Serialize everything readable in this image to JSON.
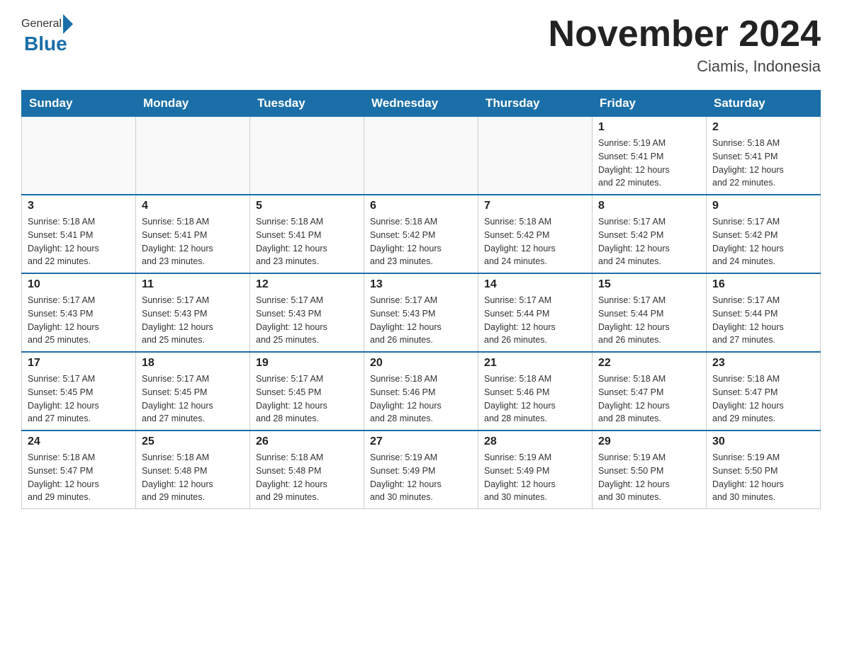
{
  "header": {
    "logo_general": "General",
    "logo_blue": "Blue",
    "title": "November 2024",
    "subtitle": "Ciamis, Indonesia"
  },
  "weekdays": [
    "Sunday",
    "Monday",
    "Tuesday",
    "Wednesday",
    "Thursday",
    "Friday",
    "Saturday"
  ],
  "weeks": [
    {
      "days": [
        {
          "number": "",
          "info": "",
          "empty": true
        },
        {
          "number": "",
          "info": "",
          "empty": true
        },
        {
          "number": "",
          "info": "",
          "empty": true
        },
        {
          "number": "",
          "info": "",
          "empty": true
        },
        {
          "number": "",
          "info": "",
          "empty": true
        },
        {
          "number": "1",
          "info": "Sunrise: 5:19 AM\nSunset: 5:41 PM\nDaylight: 12 hours\nand 22 minutes."
        },
        {
          "number": "2",
          "info": "Sunrise: 5:18 AM\nSunset: 5:41 PM\nDaylight: 12 hours\nand 22 minutes."
        }
      ]
    },
    {
      "days": [
        {
          "number": "3",
          "info": "Sunrise: 5:18 AM\nSunset: 5:41 PM\nDaylight: 12 hours\nand 22 minutes."
        },
        {
          "number": "4",
          "info": "Sunrise: 5:18 AM\nSunset: 5:41 PM\nDaylight: 12 hours\nand 23 minutes."
        },
        {
          "number": "5",
          "info": "Sunrise: 5:18 AM\nSunset: 5:41 PM\nDaylight: 12 hours\nand 23 minutes."
        },
        {
          "number": "6",
          "info": "Sunrise: 5:18 AM\nSunset: 5:42 PM\nDaylight: 12 hours\nand 23 minutes."
        },
        {
          "number": "7",
          "info": "Sunrise: 5:18 AM\nSunset: 5:42 PM\nDaylight: 12 hours\nand 24 minutes."
        },
        {
          "number": "8",
          "info": "Sunrise: 5:17 AM\nSunset: 5:42 PM\nDaylight: 12 hours\nand 24 minutes."
        },
        {
          "number": "9",
          "info": "Sunrise: 5:17 AM\nSunset: 5:42 PM\nDaylight: 12 hours\nand 24 minutes."
        }
      ]
    },
    {
      "days": [
        {
          "number": "10",
          "info": "Sunrise: 5:17 AM\nSunset: 5:43 PM\nDaylight: 12 hours\nand 25 minutes."
        },
        {
          "number": "11",
          "info": "Sunrise: 5:17 AM\nSunset: 5:43 PM\nDaylight: 12 hours\nand 25 minutes."
        },
        {
          "number": "12",
          "info": "Sunrise: 5:17 AM\nSunset: 5:43 PM\nDaylight: 12 hours\nand 25 minutes."
        },
        {
          "number": "13",
          "info": "Sunrise: 5:17 AM\nSunset: 5:43 PM\nDaylight: 12 hours\nand 26 minutes."
        },
        {
          "number": "14",
          "info": "Sunrise: 5:17 AM\nSunset: 5:44 PM\nDaylight: 12 hours\nand 26 minutes."
        },
        {
          "number": "15",
          "info": "Sunrise: 5:17 AM\nSunset: 5:44 PM\nDaylight: 12 hours\nand 26 minutes."
        },
        {
          "number": "16",
          "info": "Sunrise: 5:17 AM\nSunset: 5:44 PM\nDaylight: 12 hours\nand 27 minutes."
        }
      ]
    },
    {
      "days": [
        {
          "number": "17",
          "info": "Sunrise: 5:17 AM\nSunset: 5:45 PM\nDaylight: 12 hours\nand 27 minutes."
        },
        {
          "number": "18",
          "info": "Sunrise: 5:17 AM\nSunset: 5:45 PM\nDaylight: 12 hours\nand 27 minutes."
        },
        {
          "number": "19",
          "info": "Sunrise: 5:17 AM\nSunset: 5:45 PM\nDaylight: 12 hours\nand 28 minutes."
        },
        {
          "number": "20",
          "info": "Sunrise: 5:18 AM\nSunset: 5:46 PM\nDaylight: 12 hours\nand 28 minutes."
        },
        {
          "number": "21",
          "info": "Sunrise: 5:18 AM\nSunset: 5:46 PM\nDaylight: 12 hours\nand 28 minutes."
        },
        {
          "number": "22",
          "info": "Sunrise: 5:18 AM\nSunset: 5:47 PM\nDaylight: 12 hours\nand 28 minutes."
        },
        {
          "number": "23",
          "info": "Sunrise: 5:18 AM\nSunset: 5:47 PM\nDaylight: 12 hours\nand 29 minutes."
        }
      ]
    },
    {
      "days": [
        {
          "number": "24",
          "info": "Sunrise: 5:18 AM\nSunset: 5:47 PM\nDaylight: 12 hours\nand 29 minutes."
        },
        {
          "number": "25",
          "info": "Sunrise: 5:18 AM\nSunset: 5:48 PM\nDaylight: 12 hours\nand 29 minutes."
        },
        {
          "number": "26",
          "info": "Sunrise: 5:18 AM\nSunset: 5:48 PM\nDaylight: 12 hours\nand 29 minutes."
        },
        {
          "number": "27",
          "info": "Sunrise: 5:19 AM\nSunset: 5:49 PM\nDaylight: 12 hours\nand 30 minutes."
        },
        {
          "number": "28",
          "info": "Sunrise: 5:19 AM\nSunset: 5:49 PM\nDaylight: 12 hours\nand 30 minutes."
        },
        {
          "number": "29",
          "info": "Sunrise: 5:19 AM\nSunset: 5:50 PM\nDaylight: 12 hours\nand 30 minutes."
        },
        {
          "number": "30",
          "info": "Sunrise: 5:19 AM\nSunset: 5:50 PM\nDaylight: 12 hours\nand 30 minutes."
        }
      ]
    }
  ]
}
